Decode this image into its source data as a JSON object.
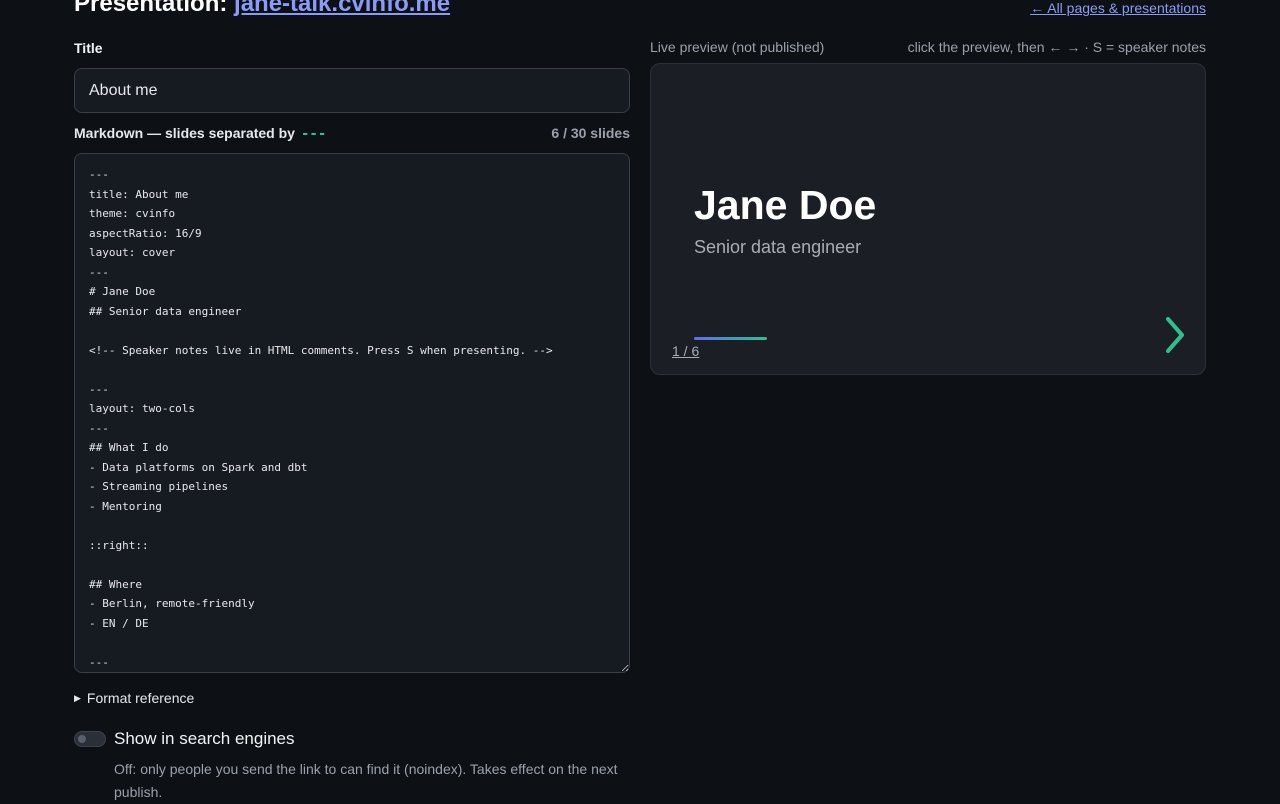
{
  "header": {
    "prefix": "Presentation: ",
    "site_link": "jane-talk.cvinfo.me",
    "back_link": "← All pages & presentations"
  },
  "form": {
    "title_label": "Title",
    "title_value": "About me",
    "markdown_label": "Markdown — slides separated by",
    "separator": "---",
    "slide_count": "6 / 30 slides",
    "markdown_value": "---\ntitle: About me\ntheme: cvinfo\naspectRatio: 16/9\nlayout: cover\n---\n# Jane Doe\n## Senior data engineer\n\n<!-- Speaker notes live in HTML comments. Press S when presenting. -->\n\n---\nlayout: two-cols\n---\n## What I do\n- Data platforms on Spark and dbt\n- Streaming pipelines\n- Mentoring\n\n::right::\n\n## Where\n- Berlin, remote-friendly\n- EN / DE\n\n---",
    "format_reference": "Format reference",
    "search_label": "Show in search engines",
    "search_enabled": false,
    "search_hint": "Off: only people you send the link to can find it (noindex). Takes effect on the next publish."
  },
  "preview": {
    "label": "Live preview (not published)",
    "hint": "click the preview, then ← → · S = speaker notes",
    "slide_title": "Jane Doe",
    "slide_subtitle": "Senior data engineer",
    "page_indicator": "1 / 6",
    "progress": 0.1667,
    "next_icon": "chevron-right-icon",
    "accent_color": "#2fbf8e",
    "link_color": "#8b9cf7"
  }
}
